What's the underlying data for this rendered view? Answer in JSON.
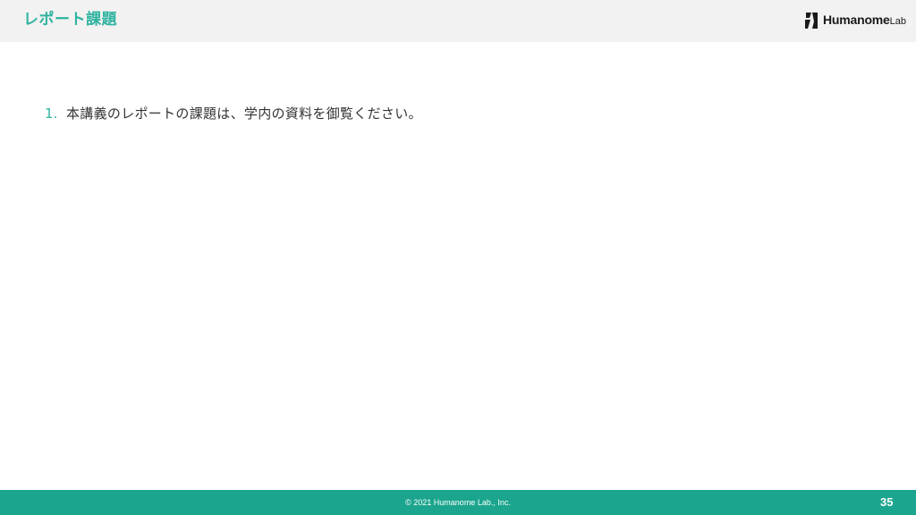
{
  "header": {
    "title": "レポート課題",
    "logo": {
      "main": "Humanome",
      "sub": "Lab",
      "icon": "humanome-logo-icon"
    }
  },
  "content": {
    "items": [
      {
        "number": "1.",
        "text": "本講義のレポートの課題は、学内の資料を御覧ください。"
      }
    ]
  },
  "footer": {
    "copyright": "© 2021 Humanome Lab., Inc.",
    "page_number": "35"
  },
  "colors": {
    "accent": "#2fb3a0",
    "footer_bg": "#1ba58e",
    "header_bg": "#f2f2f2"
  }
}
